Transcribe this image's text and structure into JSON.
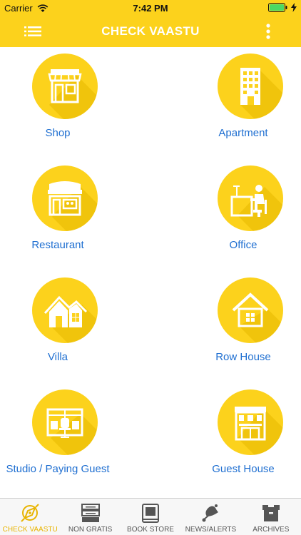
{
  "status_bar": {
    "carrier": "Carrier",
    "time": "7:42 PM"
  },
  "nav": {
    "title": "CHECK VAASTU"
  },
  "items": [
    {
      "label": "Shop",
      "icon": "shop-icon"
    },
    {
      "label": "Apartment",
      "icon": "apartment-icon"
    },
    {
      "label": "Restaurant",
      "icon": "restaurant-icon"
    },
    {
      "label": "Office",
      "icon": "office-icon"
    },
    {
      "label": "Villa",
      "icon": "villa-icon"
    },
    {
      "label": "Row House",
      "icon": "row-house-icon"
    },
    {
      "label": "Studio / Paying Guest",
      "icon": "studio-icon"
    },
    {
      "label": "Guest House",
      "icon": "guest-house-icon"
    }
  ],
  "tabs": [
    {
      "label": "CHECK VAASTU",
      "icon": "compass-icon",
      "active": true
    },
    {
      "label": "NON GRATIS",
      "icon": "stack-icon",
      "active": false
    },
    {
      "label": "BOOK STORE",
      "icon": "book-icon",
      "active": false
    },
    {
      "label": "NEWS/ALERTS",
      "icon": "bell-icon",
      "active": false
    },
    {
      "label": "ARCHIVES",
      "icon": "archive-box-icon",
      "active": false
    }
  ],
  "colors": {
    "brand_yellow": "#fcd21c",
    "link_blue": "#1f6fd1",
    "active_tab": "#e8b400"
  }
}
